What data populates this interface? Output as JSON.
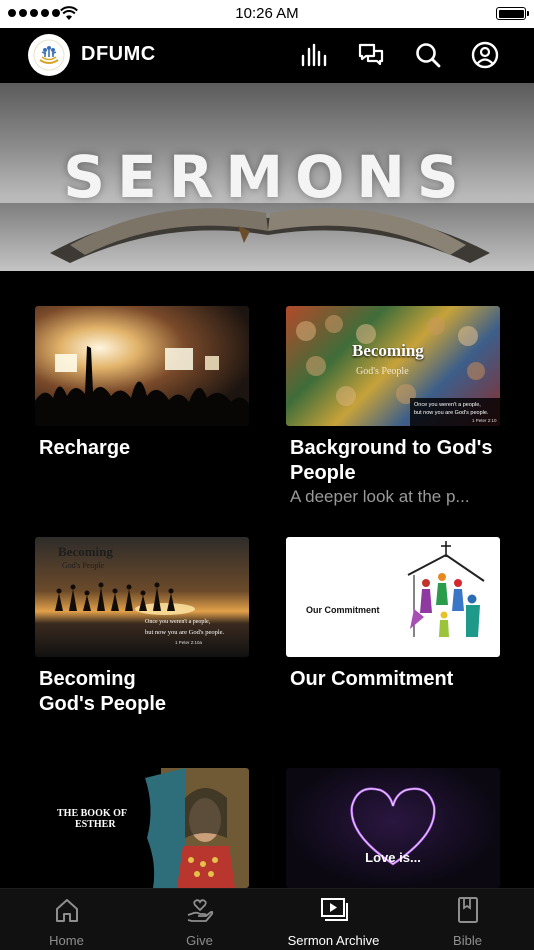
{
  "status_bar": {
    "time": "10:26 AM"
  },
  "header": {
    "title": "DFUMC",
    "icons": [
      "equalizer-icon",
      "chat-icon",
      "search-icon",
      "account-icon"
    ]
  },
  "hero": {
    "title": "SERMONS"
  },
  "cards": [
    {
      "title": "Recharge",
      "subtitle": ""
    },
    {
      "title": "Background to God's People",
      "subtitle": "A deeper look at the p..."
    },
    {
      "title": "Becoming God's People",
      "subtitle": ""
    },
    {
      "title": "Our Commitment",
      "subtitle": ""
    },
    {
      "title": "",
      "subtitle": ""
    },
    {
      "title": "",
      "subtitle": ""
    }
  ],
  "thumb_text": {
    "becoming": "Becoming",
    "gods_people": "God's People",
    "once1": "Once you weren't a people,",
    "now1": "but now you are God's people.",
    "ref1": "1 Peter 2:10",
    "once2": "Once you weren't a people,",
    "now2": "but now you are God's people.",
    "ref2": "1 Peter 2:10a",
    "our_commitment": "Our Commitment",
    "book_of_esther_1": "THE BOOK OF",
    "book_of_esther_2": "ESTHER",
    "love_is": "Love is..."
  },
  "bottom_nav": [
    {
      "label": "Home",
      "icon": "home-icon",
      "active": false
    },
    {
      "label": "Give",
      "icon": "give-icon",
      "active": false
    },
    {
      "label": "Sermon Archive",
      "icon": "sermon-archive-icon",
      "active": true
    },
    {
      "label": "Bible",
      "icon": "bible-icon",
      "active": false
    }
  ],
  "colors": {
    "background": "#000000",
    "nav_background": "#111111",
    "subtitle": "#9a9a9a",
    "inactive_nav": "#8e8e8e"
  }
}
